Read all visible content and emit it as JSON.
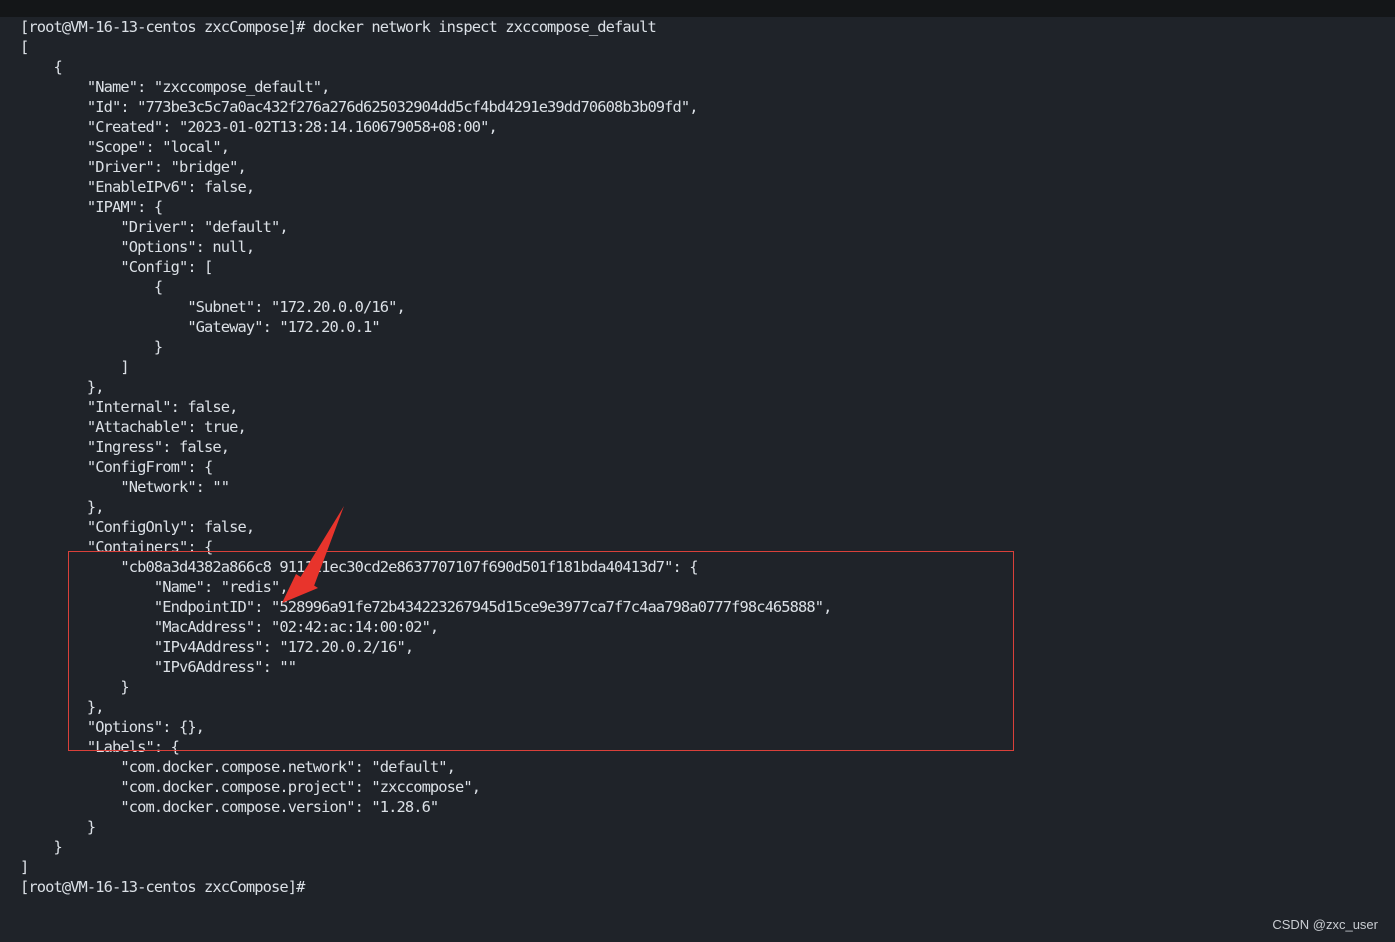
{
  "terminal": {
    "lines": [
      "[root@VM-16-13-centos zxcCompose]# docker network inspect zxccompose_default",
      "[",
      "    {",
      "        \"Name\": \"zxccompose_default\",",
      "        \"Id\": \"773be3c5c7a0ac432f276a276d625032904dd5cf4bd4291e39dd70608b3b09fd\",",
      "        \"Created\": \"2023-01-02T13:28:14.160679058+08:00\",",
      "        \"Scope\": \"local\",",
      "        \"Driver\": \"bridge\",",
      "        \"EnableIPv6\": false,",
      "        \"IPAM\": {",
      "            \"Driver\": \"default\",",
      "            \"Options\": null,",
      "            \"Config\": [",
      "                {",
      "                    \"Subnet\": \"172.20.0.0/16\",",
      "                    \"Gateway\": \"172.20.0.1\"",
      "                }",
      "            ]",
      "        },",
      "        \"Internal\": false,",
      "        \"Attachable\": true,",
      "        \"Ingress\": false,",
      "        \"ConfigFrom\": {",
      "            \"Network\": \"\"",
      "        },",
      "        \"ConfigOnly\": false,",
      "        \"Containers\": {",
      "            \"cb08a3d4382a866c8 911121ec30cd2e8637707107f690d501f181bda40413d7\": {",
      "                \"Name\": \"redis\",",
      "                \"EndpointID\": \"528996a91fe72b434223267945d15ce9e3977ca7f7c4aa798a0777f98c465888\",",
      "                \"MacAddress\": \"02:42:ac:14:00:02\",",
      "                \"IPv4Address\": \"172.20.0.2/16\",",
      "                \"IPv6Address\": \"\"",
      "            }",
      "        },",
      "        \"Options\": {},",
      "        \"Labels\": {",
      "            \"com.docker.compose.network\": \"default\",",
      "            \"com.docker.compose.project\": \"zxccompose\",",
      "            \"com.docker.compose.version\": \"1.28.6\"",
      "        }",
      "    }",
      "]",
      "[root@VM-16-13-centos zxcCompose]#"
    ]
  },
  "annotation": {
    "box_color": "#d9403a",
    "arrow_color": "#e8342c"
  },
  "watermark": {
    "text": "CSDN @zxc_user"
  },
  "colors": {
    "background": "#1f2329",
    "text": "#dbe0e6"
  }
}
